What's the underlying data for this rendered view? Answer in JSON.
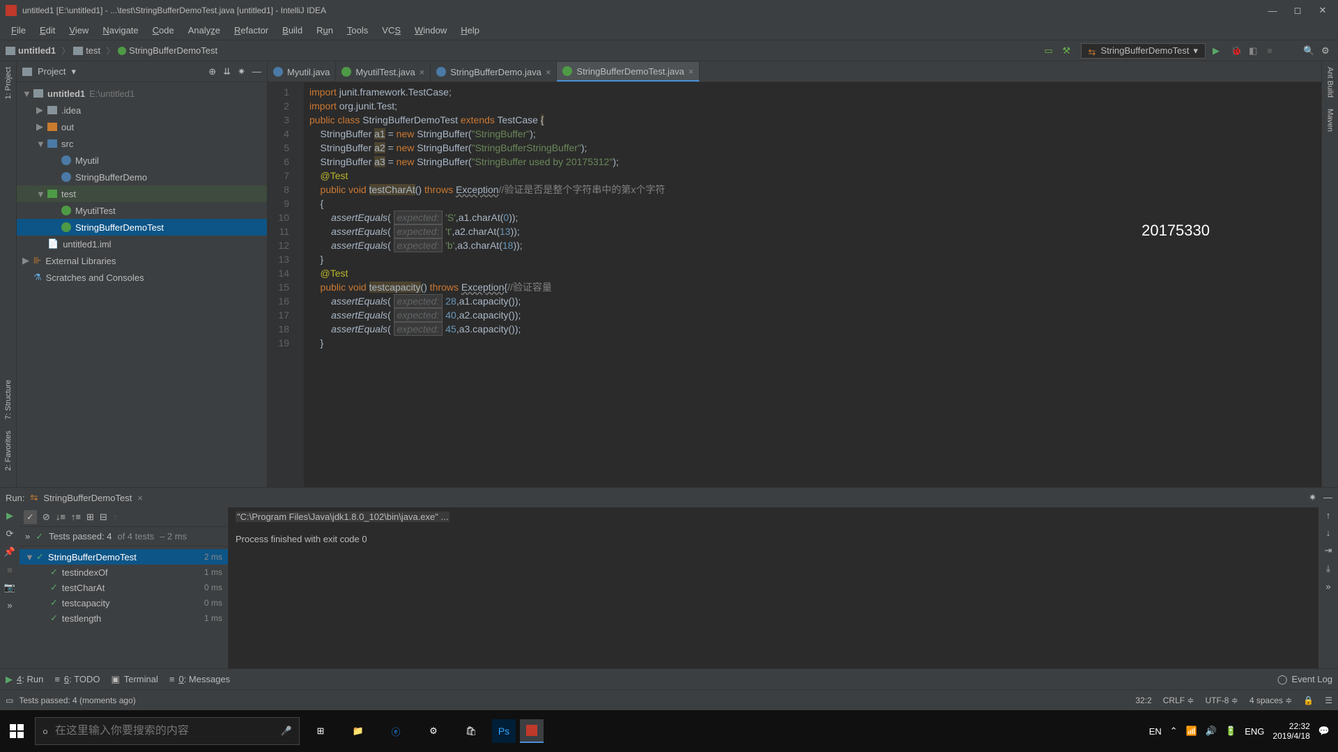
{
  "titlebar": "untitled1 [E:\\untitled1] - ...\\test\\StringBufferDemoTest.java [untitled1] - IntelliJ IDEA",
  "menus": [
    "File",
    "Edit",
    "View",
    "Navigate",
    "Code",
    "Analyze",
    "Refactor",
    "Build",
    "Run",
    "Tools",
    "VCS",
    "Window",
    "Help"
  ],
  "breadcrumbs": [
    {
      "icon": "folder",
      "label": "untitled1"
    },
    {
      "icon": "folder",
      "label": "test"
    },
    {
      "icon": "class-green",
      "label": "StringBufferDemoTest"
    }
  ],
  "run_config": "StringBufferDemoTest",
  "left_tools": [
    "1: Project",
    "7: Structure",
    "2: Favorites"
  ],
  "right_tools": [
    "Ant Build",
    "Maven"
  ],
  "project": {
    "title": "Project",
    "tree": [
      {
        "d": 0,
        "tri": "▼",
        "ico": "folder",
        "bold": true,
        "label": "untitled1",
        "suffix": "  E:\\untitled1"
      },
      {
        "d": 1,
        "tri": "▶",
        "ico": "folder",
        "label": ".idea"
      },
      {
        "d": 1,
        "tri": "▶",
        "ico": "folder-orange",
        "label": "out"
      },
      {
        "d": 1,
        "tri": "▼",
        "ico": "folder-blue",
        "label": "src"
      },
      {
        "d": 2,
        "tri": "",
        "ico": "class",
        "label": "Myutil"
      },
      {
        "d": 2,
        "tri": "",
        "ico": "class",
        "label": "StringBufferDemo"
      },
      {
        "d": 1,
        "tri": "▼",
        "ico": "folder-green",
        "label": "test",
        "cls": "folder-open"
      },
      {
        "d": 2,
        "tri": "",
        "ico": "class-green",
        "label": "MyutilTest"
      },
      {
        "d": 2,
        "tri": "",
        "ico": "class-green",
        "label": "StringBufferDemoTest",
        "cls": "sel"
      },
      {
        "d": 1,
        "tri": "",
        "ico": "file",
        "label": "untitled1.iml"
      },
      {
        "d": 0,
        "tri": "▶",
        "ico": "lib",
        "label": "External Libraries"
      },
      {
        "d": 0,
        "tri": "",
        "ico": "scratch",
        "label": "Scratches and Consoles"
      }
    ]
  },
  "tabs": [
    {
      "ico": "class",
      "label": "Myutil.java",
      "active": false
    },
    {
      "ico": "class-green",
      "label": "MyutilTest.java",
      "active": false,
      "x": true
    },
    {
      "ico": "class",
      "label": "StringBufferDemo.java",
      "active": false,
      "x": true
    },
    {
      "ico": "class-green",
      "label": "StringBufferDemoTest.java",
      "active": true,
      "x": true
    }
  ],
  "code_lines": [
    "1",
    "2",
    "3",
    "4",
    "5",
    "6",
    "7",
    "8",
    "9",
    "10",
    "11",
    "12",
    "13",
    "14",
    "15",
    "16",
    "17",
    "18",
    "19"
  ],
  "code": {
    "l1": "import junit.framework.TestCase;",
    "l2": "import org.junit.Test;",
    "l3a": "public class ",
    "l3b": "StringBufferDemoTest ",
    "l3c": "extends ",
    "l3d": "TestCase ",
    "l3e": "{",
    "l4a": "    StringBuffer ",
    "l4v": "a1",
    "l4b": " = ",
    "l4c": "new ",
    "l4d": "StringBuffer(",
    "l4e": "\"StringBuffer\"",
    "l4f": ");",
    "l5a": "    StringBuffer ",
    "l5v": "a2",
    "l5b": " = ",
    "l5c": "new ",
    "l5d": "StringBuffer(",
    "l5e": "\"StringBufferStringBuffer\"",
    "l5f": ");",
    "l6a": "    StringBuffer ",
    "l6v": "a3",
    "l6b": " = ",
    "l6c": "new ",
    "l6d": "StringBuffer(",
    "l6e": "\"StringBuffer used by 20175312\"",
    "l6f": ");",
    "l7": "    @Test",
    "l8a": "    public void ",
    "l8b": "testCharAt",
    "l8c": "() ",
    "l8d": "throws ",
    "l8e": "Exception",
    "l8f": "//验证是否是整个字符串中的第x个字符",
    "l9": "    {",
    "l10a": "        assertEquals",
    "l10p": "expected:",
    "l10b": " 'S'",
    "l10c": ",a1.charAt(",
    "l10d": "0",
    "l10e": "));",
    "l11a": "        assertEquals",
    "l11p": "expected:",
    "l11b": " 't'",
    "l11c": ",a2.charAt(",
    "l11d": "13",
    "l11e": "));",
    "l12a": "        assertEquals",
    "l12p": "expected:",
    "l12b": " 'b'",
    "l12c": ",a3.charAt(",
    "l12d": "18",
    "l12e": "));",
    "l13": "    }",
    "l14": "    @Test",
    "l15a": "    public void ",
    "l15b": "testcapacity",
    "l15c": "() ",
    "l15d": "throws ",
    "l15e": "Exception",
    "l15f": "{",
    "l15g": "//验证容量",
    "l16a": "        assertEquals",
    "l16p": "expected:",
    "l16b": " 28",
    "l16c": ",a1.capacity());",
    "l17a": "        assertEquals",
    "l17p": "expected:",
    "l17b": " 40",
    "l17c": ",a2.capacity());",
    "l18a": "        assertEquals",
    "l18p": "expected:",
    "l18b": " 45",
    "l18c": ",a3.capacity());",
    "l19": "    }"
  },
  "watermark": "20175330",
  "run": {
    "title": "Run:",
    "config": "StringBufferDemoTest",
    "status_pre": "»  ",
    "status_icon": "✓",
    "status": "Tests passed: 4",
    "status2": " of 4 tests",
    " status3": " – 2 ms",
    "tree": [
      {
        "d": 0,
        "tri": "▼",
        "ico": "✓",
        "label": "StringBufferDemoTest",
        "time": "2 ms",
        "cls": "sel"
      },
      {
        "d": 1,
        "tri": "",
        "ico": "✓",
        "label": "testindexOf",
        "time": "1 ms"
      },
      {
        "d": 1,
        "tri": "",
        "ico": "✓",
        "label": "testCharAt",
        "time": "0 ms"
      },
      {
        "d": 1,
        "tri": "",
        "ico": "✓",
        "label": "testcapacity",
        "time": "0 ms"
      },
      {
        "d": 1,
        "tri": "",
        "ico": "✓",
        "label": "testlength",
        "time": "1 ms"
      }
    ],
    "out1": "\"C:\\Program Files\\Java\\jdk1.8.0_102\\bin\\java.exe\" ...",
    "out2": "Process finished with exit code 0"
  },
  "bottom": [
    {
      "ico": "▶",
      "label": "4: Run",
      "u": true
    },
    {
      "ico": "≡",
      "label": "6: TODO"
    },
    {
      "ico": "▣",
      "label": "Terminal"
    },
    {
      "ico": "≡",
      "label": "0: Messages"
    }
  ],
  "bottom_right": "Event Log",
  "status_left": "Tests passed: 4 (moments ago)",
  "status_right": [
    "32:2",
    "CRLF ≑",
    "UTF-8 ≑",
    "4 spaces ≑",
    "🔒",
    "☰"
  ],
  "taskbar": {
    "search_placeholder": "在这里输入你要搜索的内容",
    "lang1": "EN",
    "lang2": "ENG",
    "time": "22:32",
    "date": "2019/4/18"
  }
}
